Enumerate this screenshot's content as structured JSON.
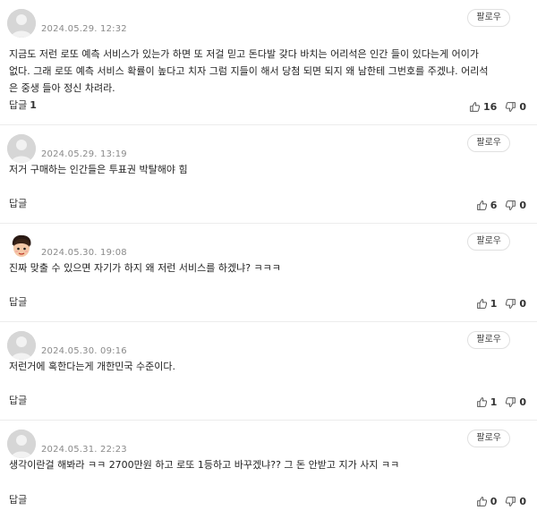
{
  "comments": [
    {
      "timestamp": "2024.05.29. 12:32",
      "follow_label": "팔로우",
      "text": "지금도 저런 로또 예측 서비스가 있는가 하면 또 저걸 믿고 돈다발 갖다 바치는 어리석은 인간 들이 있다는게 어이가\n없다. 그래 로또 예측 서비스 확률이 높다고 치자 그럼 지들이 해서 당첨 되면 되지 왜 남한테 그번호를 주겠냐. 어리석\n은 중생 들아 정신 차려라.",
      "reply_label": "답글",
      "reply_count": "1",
      "likes": "16",
      "dislikes": "0",
      "avatar": "default-avatar"
    },
    {
      "timestamp": "2024.05.29. 13:19",
      "follow_label": "팔로우",
      "text": "저거 구매하는 인간들은 투표권 박탈해야 힘",
      "reply_label": "답글",
      "reply_count": "",
      "likes": "6",
      "dislikes": "0",
      "avatar": "default-avatar"
    },
    {
      "timestamp": "2024.05.30. 19:08",
      "follow_label": "팔로우",
      "text": "진짜 맞출 수 있으면 자기가 하지 왜 저런 서비스를 하겠냐? ㅋㅋㅋ",
      "reply_label": "답글",
      "reply_count": "",
      "likes": "1",
      "dislikes": "0",
      "avatar": "character-avatar"
    },
    {
      "timestamp": "2024.05.30. 09:16",
      "follow_label": "팔로우",
      "text": "저런거에 혹한다는게 개한민국 수준이다.",
      "reply_label": "답글",
      "reply_count": "",
      "likes": "1",
      "dislikes": "0",
      "avatar": "default-avatar"
    },
    {
      "timestamp": "2024.05.31. 22:23",
      "follow_label": "팔로우",
      "text": "생각이란걸 해봐라 ㅋㅋ 2700만원 하고 로또 1등하고 바꾸겠냐?? 그 돈 안받고 지가 사지 ㅋㅋ",
      "reply_label": "답글",
      "reply_count": "",
      "likes": "0",
      "dislikes": "0",
      "avatar": "default-avatar"
    }
  ],
  "colors": {
    "avatar_bg": "#d9d9d9",
    "border": "#ececec",
    "timestamp": "#8a8a8a"
  }
}
